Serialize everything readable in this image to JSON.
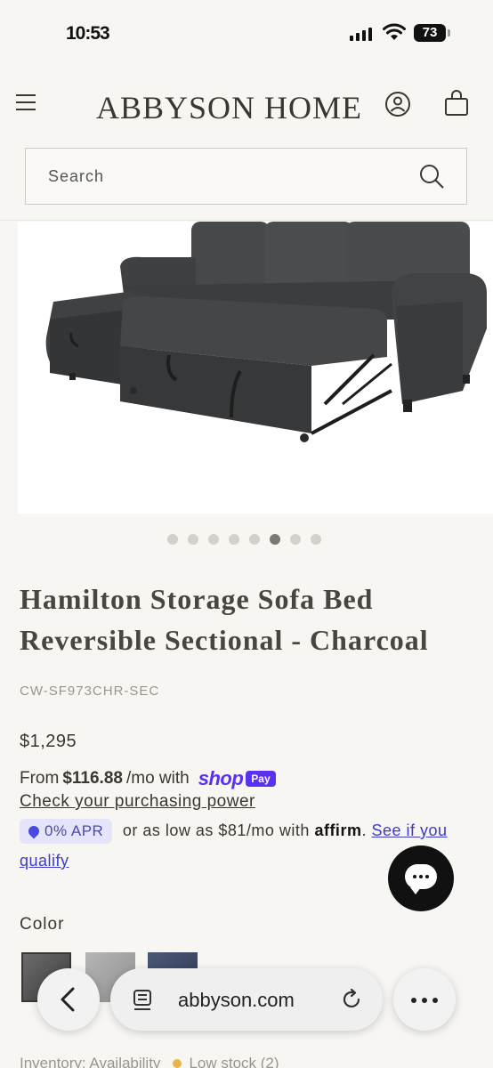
{
  "status_bar": {
    "time": "10:53",
    "battery": "73"
  },
  "header": {
    "logo": "ABBYSON HOME",
    "menu_icon": "hamburger-menu-icon",
    "account_icon": "user-account-icon",
    "cart_icon": "shopping-bag-icon"
  },
  "search": {
    "placeholder": "Search"
  },
  "gallery": {
    "image_count": 8,
    "active_index": 5
  },
  "product": {
    "title": "Hamilton Storage Sofa Bed Reversible Sectional - Charcoal",
    "sku": "CW-SF973CHR-SEC",
    "price": "$1,295",
    "installment_prefix": "From",
    "installment_amount": "$116.88",
    "installment_suffix": "/mo with",
    "shop_logo": "shop",
    "shop_pay": "Pay",
    "check_power": "Check your purchasing power",
    "apr_badge": "0% APR",
    "affirm_text": "or as low as $81/mo with",
    "affirm_logo": "affirm",
    "affirm_link": "See if you qualify",
    "color_label": "Color",
    "colors": [
      {
        "name": "Charcoal",
        "hex": "#4a4a4a",
        "selected": true
      },
      {
        "name": "Gray",
        "hex": "#a3a3a3",
        "selected": false
      },
      {
        "name": "Navy",
        "hex": "#3d4865",
        "selected": false
      }
    ],
    "inventory_label": "Inventory: Availability",
    "inventory_status": "Low stock (2)"
  },
  "browser": {
    "url": "abbyson.com"
  },
  "colors": {
    "accent_shop": "#5a31f4",
    "affirm_link": "#3b3bc8",
    "background": "#f8f6f3"
  }
}
